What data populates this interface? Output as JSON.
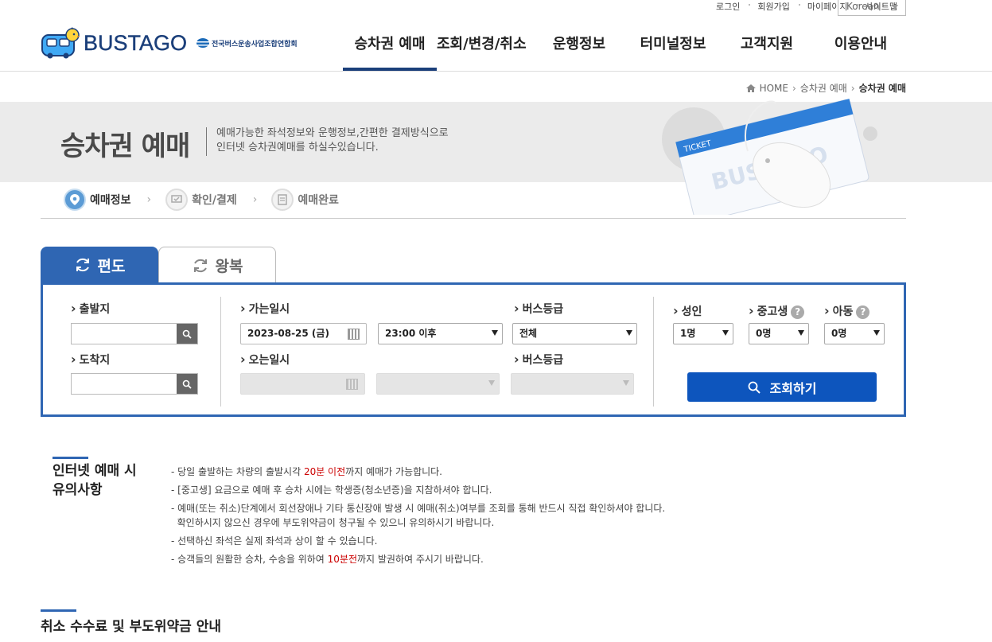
{
  "util": {
    "login": "로그인",
    "join": "회원가입",
    "mypage": "마이페이지",
    "sitemap": "사이트맵",
    "lang": "Korean"
  },
  "logo": {
    "name": "BUSTAGO",
    "assoc": "전국버스운송사업조합연합회"
  },
  "gnb": [
    {
      "label": "승차권 예매",
      "active": true
    },
    {
      "label": "조회/변경/취소",
      "active": false
    },
    {
      "label": "운행정보",
      "active": false
    },
    {
      "label": "터미널정보",
      "active": false
    },
    {
      "label": "고객지원",
      "active": false
    },
    {
      "label": "이용안내",
      "active": false
    }
  ],
  "breadcrumb": {
    "home": "HOME",
    "level1": "승차권 예매",
    "current": "승차권 예매"
  },
  "banner": {
    "title": "승차권 예매",
    "desc1": "예매가능한 좌석정보와 운행정보,간편한 결제방식으로",
    "desc2": "인터넷 승차권예매를 하실수있습니다.",
    "ticket_label": "TICKET",
    "ticket_brand": "BUSTAGO"
  },
  "steps": [
    {
      "label": "예매정보",
      "active": true
    },
    {
      "label": "확인/결제",
      "active": false
    },
    {
      "label": "예매완료",
      "active": false
    }
  ],
  "tabs": {
    "oneway": "편도",
    "round": "왕복"
  },
  "form": {
    "departure_label": "출발지",
    "arrival_label": "도착지",
    "go_date_label": "가는일시",
    "go_date_value": "2023-08-25 (금)",
    "go_time_value": "23:00 이후",
    "bus_grade_label": "버스등급",
    "bus_grade_value": "전체",
    "return_date_label": "오는일시",
    "return_grade_label": "버스등급",
    "adult_label": "성인",
    "adult_value": "1명",
    "teen_label": "중고생",
    "teen_value": "0명",
    "child_label": "아동",
    "child_value": "0명",
    "help": "?",
    "search_button": "조회하기"
  },
  "notice": {
    "title1": "인터넷 예매 시",
    "title2": "유의사항",
    "items": [
      {
        "pre": "- 당일 출발하는 차량의 출발시각 ",
        "red": "20분 이전",
        "post": "까지 예매가 가능합니다."
      },
      {
        "pre": "- [중고생] 요금으로 예매 후 승차 시에는 학생증(청소년증)을 지참하셔야 합니다.",
        "red": "",
        "post": ""
      },
      {
        "pre": "- 예매(또는 취소)단계에서 회선장애나 기타 통신장애 발생 시 예매(취소)여부를 조회를 통해 반드시 직접 확인하셔야 합니다.",
        "red": "",
        "post": ""
      },
      {
        "pre": "  확인하시지 않으신 경우에 부도위약금이 청구될 수 있으니 유의하시기 바랍니다.",
        "red": "",
        "post": ""
      },
      {
        "pre": "- 선택하신 좌석은 실제 좌석과 상이 할 수 있습니다.",
        "red": "",
        "post": ""
      },
      {
        "pre": "- 승객들의 원활한 승차, 수송을 위하여 ",
        "red": "10분전",
        "post": "까지 발권하여 주시기 바랍니다."
      }
    ]
  },
  "section2": {
    "title": "취소 수수료 및 부도위약금 안내"
  },
  "colors": {
    "brand": "#1b3f7a",
    "accent": "#2f66b3",
    "button": "#0d55bd",
    "highlight": "#cc0000"
  }
}
